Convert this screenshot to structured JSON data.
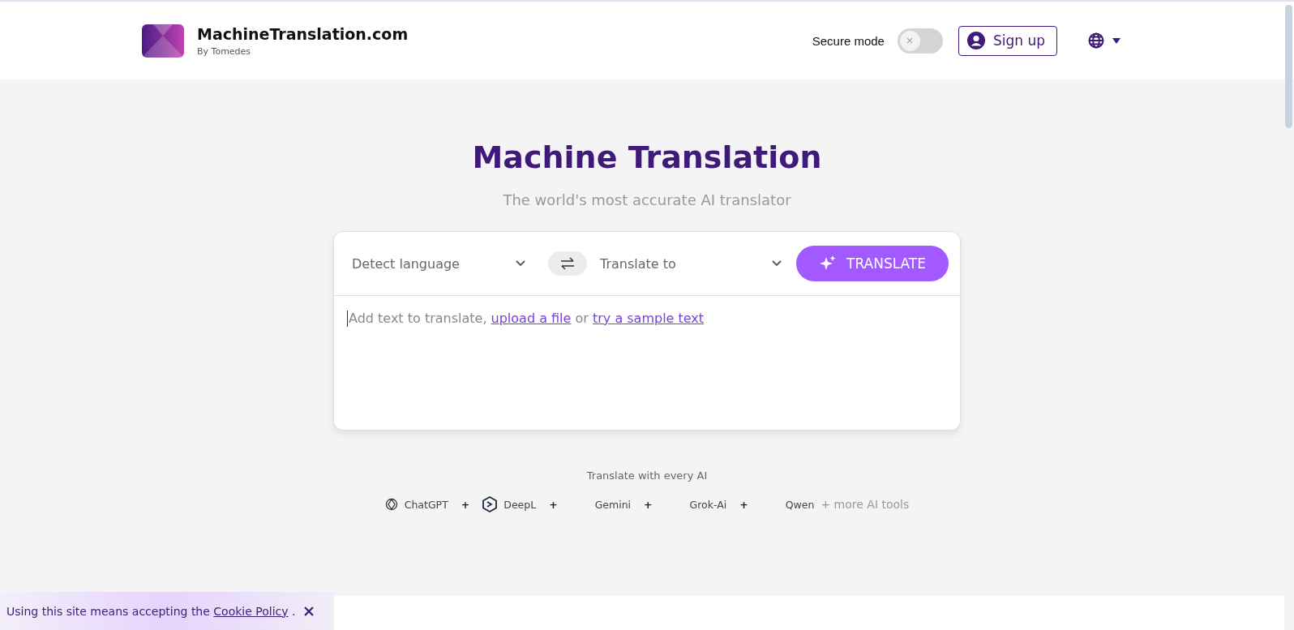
{
  "header": {
    "brand": "MachineTranslation.com",
    "byline": "By Tomedes",
    "secure_mode": {
      "label": "Secure mode",
      "on": false
    },
    "sign_up": "Sign up"
  },
  "hero": {
    "title": "Machine Translation",
    "subtitle": "The world's most accurate AI translator"
  },
  "translator": {
    "source": {
      "placeholder": "Detect language"
    },
    "target": {
      "placeholder": "Translate to"
    },
    "button": "TRANSLATE",
    "editor": {
      "lead": "Add text to translate,",
      "upload_link": "upload a file",
      "or": "or",
      "sample_link": "try a sample text"
    }
  },
  "ai_tools": {
    "caption": "Translate with every AI",
    "items": [
      {
        "name": "ChatGPT",
        "kind": "chatgpt",
        "joiner": "+"
      },
      {
        "name": "DeepL",
        "kind": "deepl",
        "joiner": "+"
      },
      {
        "name": "Gemini",
        "kind": "plain",
        "joiner": "+"
      },
      {
        "name": "Grok-Ai",
        "kind": "plain",
        "joiner": "+"
      },
      {
        "name": "Qwen",
        "kind": "plain"
      }
    ],
    "more": "+ more AI tools"
  },
  "cookie_banner": {
    "text": "Using this site means accepting the",
    "link": "Cookie Policy",
    "end": "."
  }
}
